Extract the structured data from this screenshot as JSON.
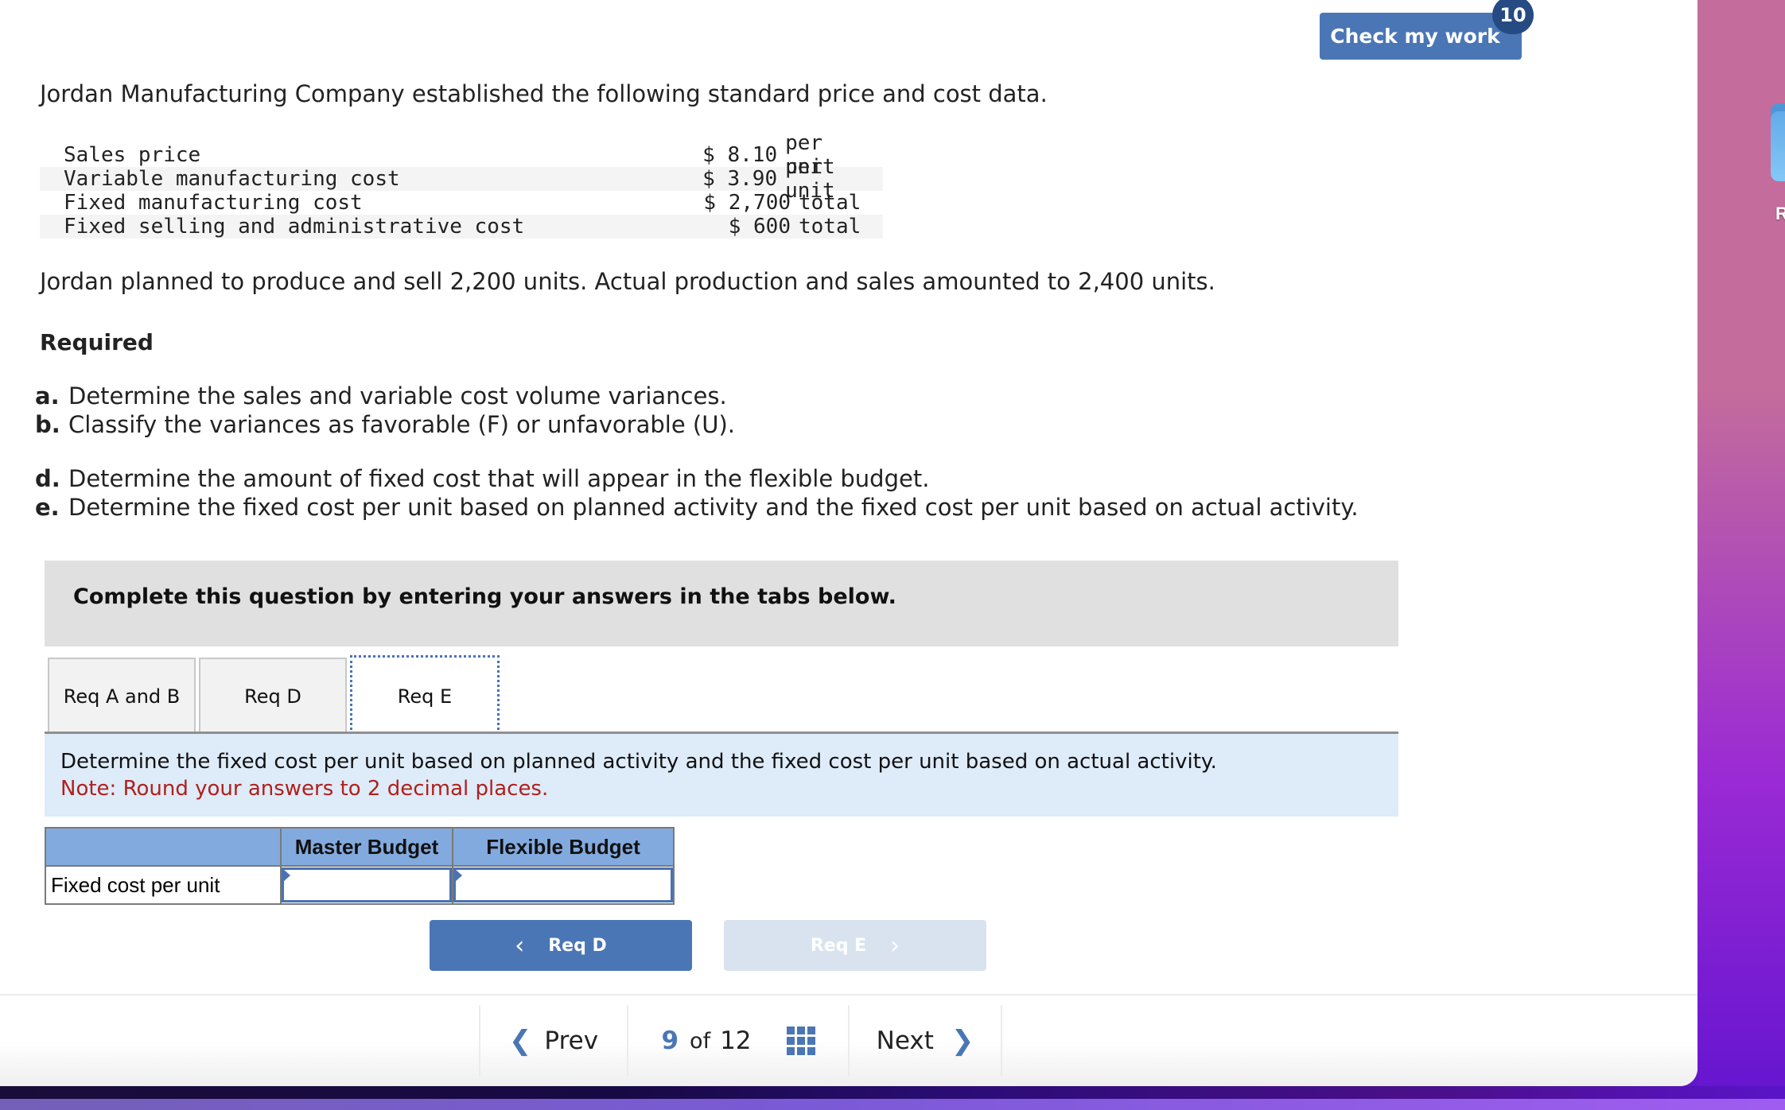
{
  "header": {
    "check_button_label": "Check my work",
    "check_badge": "10"
  },
  "problem": {
    "intro": "Jordan Manufacturing Company established the following standard price and cost data.",
    "cost_data": [
      {
        "label": "Sales price",
        "amount": "$ 8.10",
        "unit": "per unit"
      },
      {
        "label": "Variable manufacturing cost",
        "amount": "$ 3.90",
        "unit": "per unit"
      },
      {
        "label": "Fixed manufacturing cost",
        "amount": "$ 2,700",
        "unit": "total"
      },
      {
        "label": "Fixed selling and administrative cost",
        "amount": "$ 600",
        "unit": "total"
      }
    ],
    "planned_text": "Jordan planned to produce and sell 2,200 units. Actual production and sales amounted to 2,400 units.",
    "required_heading": "Required",
    "requirements": [
      {
        "letter": "a.",
        "text": "Determine the sales and variable cost volume variances."
      },
      {
        "letter": "b.",
        "text": "Classify the variances as favorable (F) or unfavorable (U)."
      },
      {
        "letter": "d.",
        "text": "Determine the amount of fixed cost that will appear in the flexible budget."
      },
      {
        "letter": "e.",
        "text": "Determine the fixed cost per unit based on planned activity and the fixed cost per unit based on actual activity."
      }
    ]
  },
  "instructions": "Complete this question by entering your answers in the tabs below.",
  "tabs": [
    {
      "label": "Req A and B",
      "active": false
    },
    {
      "label": "Req D",
      "active": false
    },
    {
      "label": "Req E",
      "active": true
    }
  ],
  "tab_content": {
    "prompt": "Determine the fixed cost per unit based on planned activity and the fixed cost per unit based on actual activity.",
    "note": "Note: Round your answers to 2 decimal places."
  },
  "answer_table": {
    "columns": [
      "",
      "Master Budget",
      "Flexible Budget"
    ],
    "rows": [
      {
        "label": "Fixed cost per unit",
        "master_value": "",
        "flexible_value": ""
      }
    ]
  },
  "nav_buttons": {
    "prev_label": "Req D",
    "next_label": "Req E"
  },
  "footer": {
    "prev_label": "Prev",
    "current": "9",
    "of_label": "of",
    "total": "12",
    "next_label": "Next"
  },
  "colors": {
    "primary": "#4a76b6",
    "badge": "#264a82",
    "note_red": "#b0201c",
    "table_header": "#82aade",
    "note_bg": "#deebf8"
  },
  "desktop": {
    "label_fragment": "R"
  }
}
